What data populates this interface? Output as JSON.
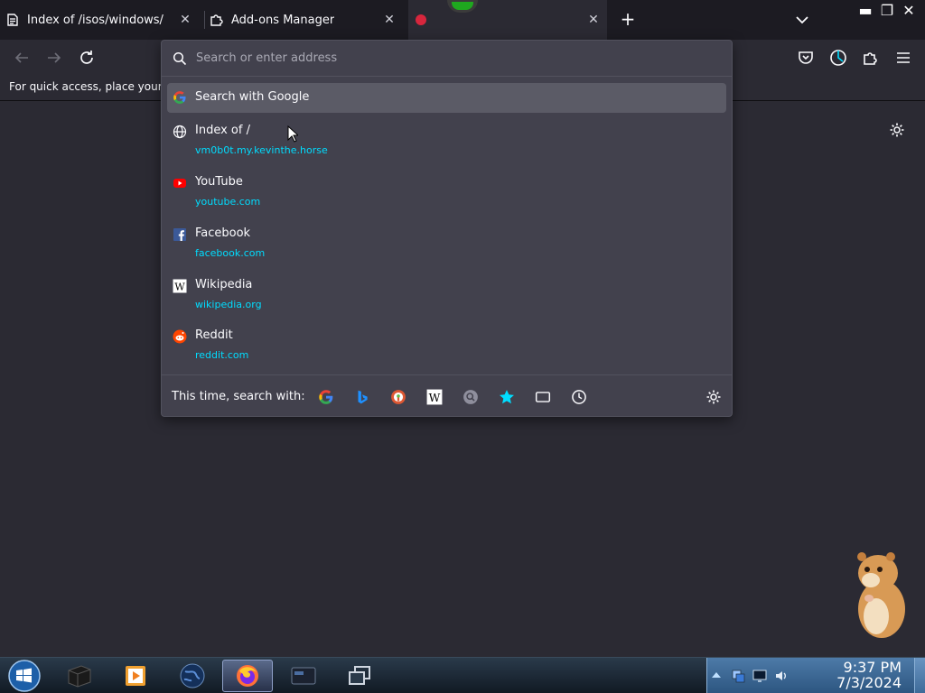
{
  "tabs": [
    {
      "title": "Index of /isos/windows/",
      "icon": "document-stack-icon"
    },
    {
      "title": "Add-ons Manager",
      "icon": "puzzle-icon"
    },
    {
      "title": "",
      "icon": "red-favicon"
    }
  ],
  "new_tab_label": "+",
  "bookmarks_bar": {
    "text": "For quick access, place your bo"
  },
  "urlbar": {
    "placeholder": "Search or enter address",
    "value": ""
  },
  "results": [
    {
      "title": "Search with Google",
      "url": "",
      "icon": "google-icon",
      "selected": true
    },
    {
      "title": "Index of /",
      "url": "vm0b0t.my.kevinthe.horse",
      "icon": "globe-icon"
    },
    {
      "title": "YouTube",
      "url": "youtube.com",
      "icon": "youtube-icon"
    },
    {
      "title": "Facebook",
      "url": "facebook.com",
      "icon": "facebook-icon"
    },
    {
      "title": "Wikipedia",
      "url": "wikipedia.org",
      "icon": "wikipedia-icon"
    },
    {
      "title": "Reddit",
      "url": "reddit.com",
      "icon": "reddit-icon"
    }
  ],
  "oneoff": {
    "label": "This time, search with:",
    "engines": [
      "google-icon",
      "bing-icon",
      "duckduckgo-icon",
      "wikipedia-icon",
      "search-engine-icon",
      "bookmarks-star-icon",
      "tabs-icon",
      "history-clock-icon"
    ]
  },
  "taskbar": {
    "time": "9:37 PM",
    "date": "7/3/2024"
  },
  "colors": {
    "accent_link": "#00ddff",
    "panel_bg": "#42414d",
    "selected_bg": "#5b5b66",
    "window_bg": "#2b2a33"
  }
}
